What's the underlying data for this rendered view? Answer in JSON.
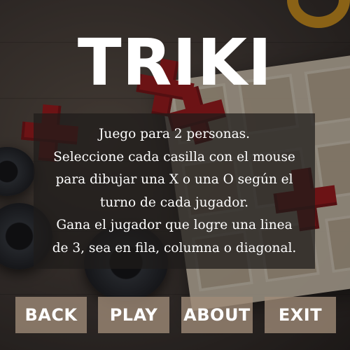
{
  "title": "TRIKI",
  "instructions": [
    "Juego para 2 personas.",
    "Seleccione cada casilla con el mouse",
    "para dibujar una X o una O según el",
    "turno de cada jugador.",
    "Gana el jugador que logre una linea",
    "de 3, sea en fila, columna o diagonal."
  ],
  "buttons": {
    "back": "BACK",
    "play": "PLAY",
    "about": "ABOUT",
    "exit": "EXIT"
  },
  "colors": {
    "button_bg": "#a08c78",
    "title_text": "#ffffff",
    "piece_red": "#9c1418"
  }
}
